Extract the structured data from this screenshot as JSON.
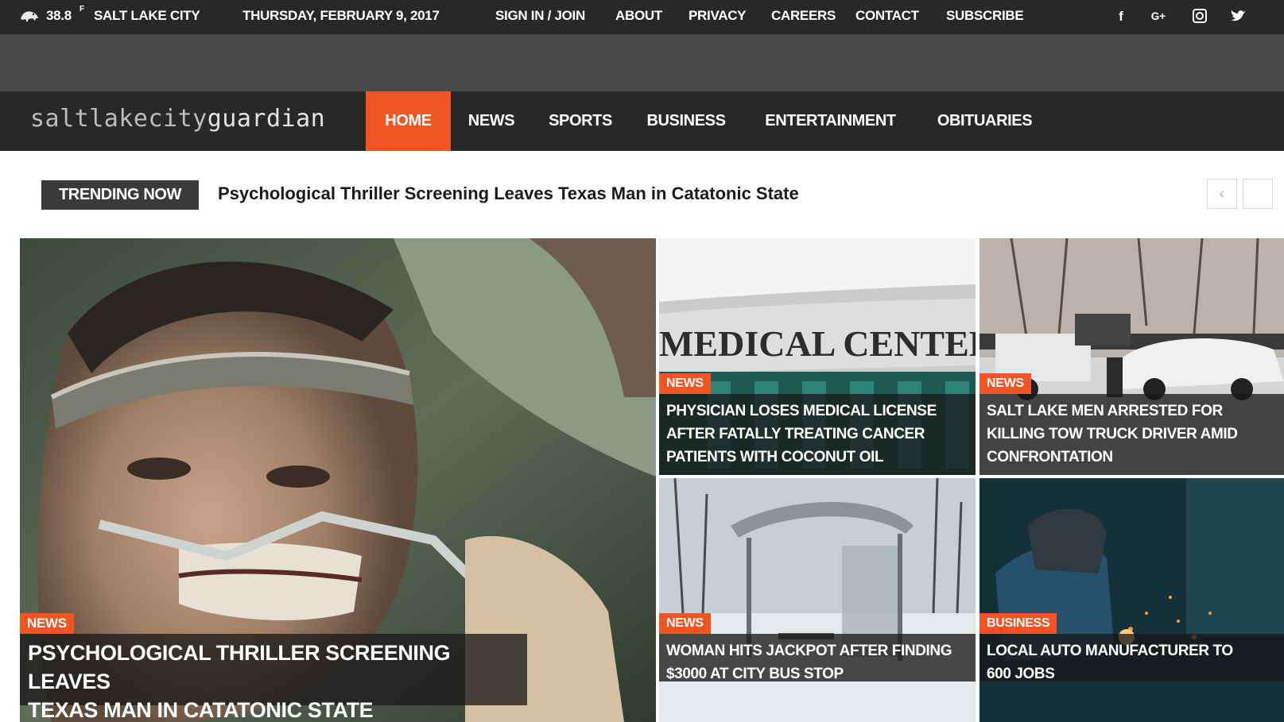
{
  "topbar": {
    "temperature": "38.8",
    "unit": "F",
    "city": "SALT LAKE CITY",
    "date": "THURSDAY, FEBRUARY 9, 2017",
    "links": [
      "SIGN IN / JOIN",
      "ABOUT",
      "PRIVACY",
      "CAREERS",
      "CONTACT",
      "SUBSCRIBE"
    ],
    "social_icons": [
      "facebook-icon",
      "google-plus-icon",
      "instagram-icon",
      "twitter-icon"
    ],
    "social_glyphs": [
      "f",
      "G+",
      "◎",
      "🐦"
    ]
  },
  "logo": {
    "part1": "saltlakecity",
    "part2": "guardian"
  },
  "nav": {
    "items": [
      "HOME",
      "NEWS",
      "SPORTS",
      "BUSINESS",
      "ENTERTAINMENT",
      "OBITUARIES"
    ],
    "active": "HOME"
  },
  "trending": {
    "label": "TRENDING NOW",
    "headline": "Psychological Thriller Screening Leaves Texas Man in Catatonic State",
    "prev_glyph": "‹"
  },
  "cards": {
    "main": {
      "category": "NEWS",
      "title_line1": "PSYCHOLOGICAL THRILLER SCREENING LEAVES",
      "title_line2": "TEXAS MAN IN CATATONIC STATE"
    },
    "medical": {
      "category": "NEWS",
      "image_text": "MEDICAL CENTER",
      "title_line1": "PHYSICIAN LOSES MEDICAL LICENSE",
      "title_line2": "AFTER FATALLY TREATING CANCER",
      "title_line3": "PATIENTS WITH COCONUT OIL"
    },
    "tow": {
      "category": "NEWS",
      "title_line1": "SALT LAKE MEN ARRESTED FOR",
      "title_line2": "KILLING TOW TRUCK DRIVER AMID",
      "title_line3": "CONFRONTATION"
    },
    "bus": {
      "category": "NEWS",
      "title_line1": "WOMAN HITS JACKPOT AFTER FINDING",
      "title_line2": "$3000 AT CITY BUS STOP"
    },
    "auto": {
      "category": "BUSINESS",
      "title_line1": "LOCAL AUTO MANUFACTURER TO",
      "title_line2": "600 JOBS"
    }
  },
  "colors": {
    "accent": "#f25524",
    "dark_bar": "#282828",
    "ad_strip": "#4a4a4a"
  }
}
